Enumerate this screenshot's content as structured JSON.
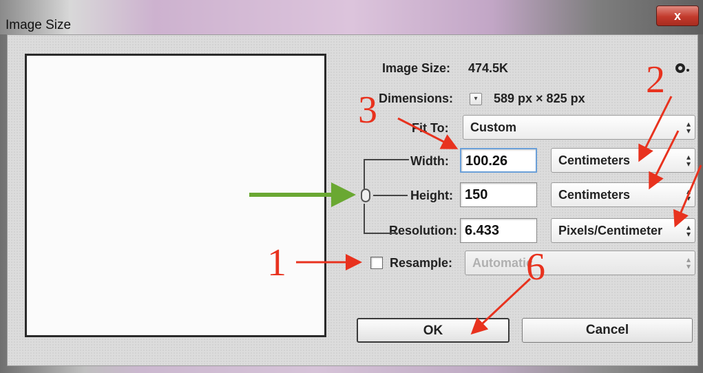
{
  "window": {
    "title": "Image Size",
    "close_label": "x"
  },
  "info": {
    "image_size_label": "Image Size:",
    "image_size_value": "474.5K",
    "dimensions_label": "Dimensions:",
    "dimensions_value": "589 px  ×  825 px"
  },
  "fit_to": {
    "label": "Fit To:",
    "value": "Custom"
  },
  "width": {
    "label": "Width:",
    "value": "100.26",
    "unit": "Centimeters"
  },
  "height": {
    "label": "Height:",
    "value": "150",
    "unit": "Centimeters"
  },
  "resolution": {
    "label": "Resolution:",
    "value": "6.433",
    "unit": "Pixels/Centimeter"
  },
  "resample": {
    "label": "Resample:",
    "value": "Automatic",
    "checked": false
  },
  "buttons": {
    "ok": "OK",
    "cancel": "Cancel"
  },
  "annotations": {
    "n1": "1",
    "n2": "2",
    "n3": "3",
    "n6": "6"
  },
  "colors": {
    "annotation_red": "#e8321e",
    "annotation_green": "#6aa832"
  },
  "icons": {
    "gear": "gear-icon",
    "dimensions_toggle": "chevron-down-icon",
    "constrain_link": "link-icon"
  }
}
